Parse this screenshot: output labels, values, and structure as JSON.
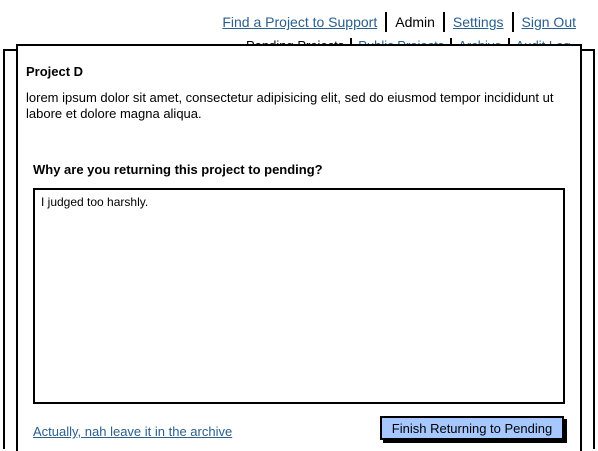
{
  "nav": {
    "find_project": "Find a Project to Support",
    "admin": "Admin",
    "settings": "Settings",
    "sign_out": "Sign Out"
  },
  "subnav": {
    "pending_projects": "Pending Projects",
    "public_projects": "Public Projects",
    "archive": "Archive",
    "audit_log": "Audit Log"
  },
  "dialog": {
    "title": "Project D",
    "description": "lorem ipsum dolor sit amet, consectetur adipisicing elit, sed do eiusmod tempor incididunt ut labore et dolore magna aliqua.",
    "question": "Why are you returning this project to pending?",
    "reason_value": "I judged too harshly.",
    "cancel_label": "Actually, nah leave it in the archive",
    "finish_label": "Finish Returning to Pending"
  }
}
